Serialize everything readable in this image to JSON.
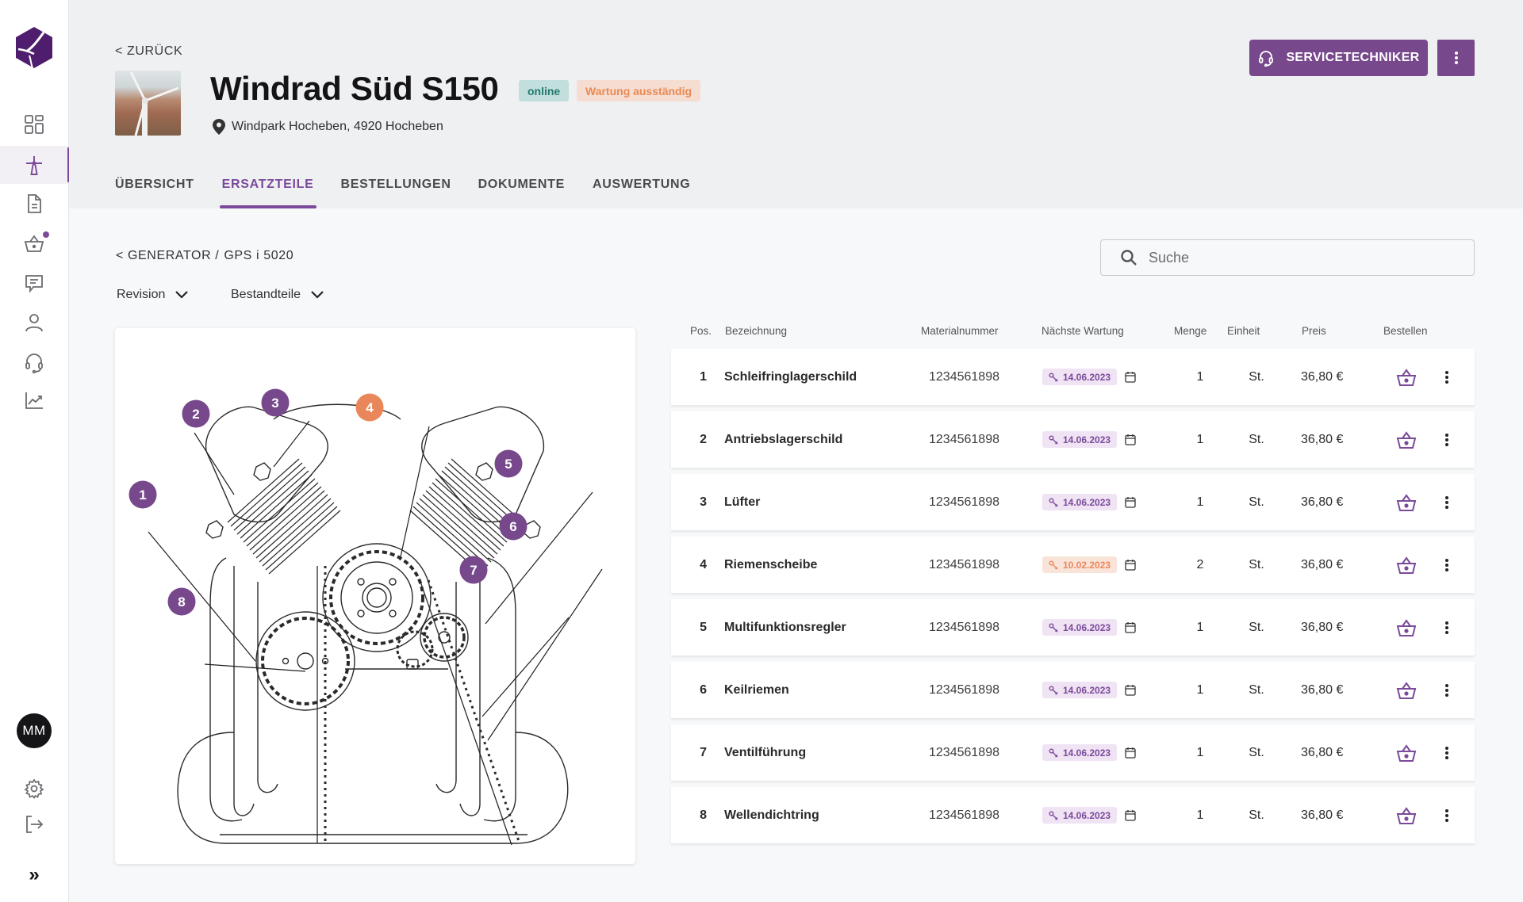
{
  "sidebar": {
    "logo": "windpark-logo",
    "items": [
      {
        "name": "dashboard",
        "icon": "dashboard-grid-icon",
        "active": false
      },
      {
        "name": "wind-turbines",
        "icon": "wind-turbine-icon",
        "active": true
      },
      {
        "name": "documents",
        "icon": "document-icon",
        "active": false
      },
      {
        "name": "cart",
        "icon": "basket-icon",
        "active": false,
        "notification": true
      },
      {
        "name": "messages",
        "icon": "chat-icon",
        "active": false
      },
      {
        "name": "users",
        "icon": "user-icon",
        "active": false
      },
      {
        "name": "support",
        "icon": "headset-icon",
        "active": false
      },
      {
        "name": "analytics",
        "icon": "chart-icon",
        "active": false
      }
    ],
    "avatar_initials": "MM",
    "bottom": [
      {
        "name": "settings",
        "icon": "gear-icon"
      },
      {
        "name": "logout",
        "icon": "logout-icon"
      },
      {
        "name": "expand",
        "icon": "double-chevron-right-icon"
      }
    ],
    "expand_glyph": "»"
  },
  "header": {
    "back_label": "< ZURÜCK",
    "title": "Windrad Süd S150",
    "badges": {
      "online": "online",
      "maintenance": "Wartung ausständig"
    },
    "location": "Windpark Hocheben, 4920 Hocheben",
    "service_button": "SERVICETECHNIKER",
    "tabs": [
      {
        "label": "ÜBERSICHT",
        "active": false
      },
      {
        "label": "ERSATZTEILE",
        "active": true
      },
      {
        "label": "BESTELLUNGEN",
        "active": false
      },
      {
        "label": "DOKUMENTE",
        "active": false
      },
      {
        "label": "AUSWERTUNG",
        "active": false
      }
    ]
  },
  "content": {
    "breadcrumb": {
      "parent": "< GENERATOR /",
      "current": "GPS i 5020"
    },
    "filters": {
      "revision": "Revision",
      "components": "Bestandteile"
    },
    "search": {
      "placeholder": "Suche",
      "value": ""
    }
  },
  "diagram": {
    "markers": [
      {
        "label": "1",
        "status": "ok"
      },
      {
        "label": "2",
        "status": "ok"
      },
      {
        "label": "3",
        "status": "ok"
      },
      {
        "label": "4",
        "status": "due"
      },
      {
        "label": "5",
        "status": "ok"
      },
      {
        "label": "6",
        "status": "ok"
      },
      {
        "label": "7",
        "status": "ok"
      },
      {
        "label": "8",
        "status": "ok"
      }
    ]
  },
  "colors": {
    "accent": "#77488c",
    "accent_text": "#7b4a9a",
    "warning": "#e9875a",
    "online": "#207a6e"
  },
  "table": {
    "columns": [
      "Pos.",
      "Bezeichnung",
      "Materialnummer",
      "Nächste Wartung",
      "Menge",
      "Einheit",
      "Preis",
      "Bestellen"
    ],
    "rows": [
      {
        "pos": "1",
        "name": "Schleifringlagerschild",
        "material": "1234561898",
        "next_maintenance": "14.06.2023",
        "status": "ok",
        "qty": "1",
        "unit": "St.",
        "price": "36,80 €"
      },
      {
        "pos": "2",
        "name": "Antriebslagerschild",
        "material": "1234561898",
        "next_maintenance": "14.06.2023",
        "status": "ok",
        "qty": "1",
        "unit": "St.",
        "price": "36,80 €"
      },
      {
        "pos": "3",
        "name": "Lüfter",
        "material": "1234561898",
        "next_maintenance": "14.06.2023",
        "status": "ok",
        "qty": "1",
        "unit": "St.",
        "price": "36,80 €"
      },
      {
        "pos": "4",
        "name": "Riemenscheibe",
        "material": "1234561898",
        "next_maintenance": "10.02.2023",
        "status": "due",
        "qty": "2",
        "unit": "St.",
        "price": "36,80 €"
      },
      {
        "pos": "5",
        "name": "Multifunktionsregler",
        "material": "1234561898",
        "next_maintenance": "14.06.2023",
        "status": "ok",
        "qty": "1",
        "unit": "St.",
        "price": "36,80 €"
      },
      {
        "pos": "6",
        "name": "Keilriemen",
        "material": "1234561898",
        "next_maintenance": "14.06.2023",
        "status": "ok",
        "qty": "1",
        "unit": "St.",
        "price": "36,80 €"
      },
      {
        "pos": "7",
        "name": "Ventilführung",
        "material": "1234561898",
        "next_maintenance": "14.06.2023",
        "status": "ok",
        "qty": "1",
        "unit": "St.",
        "price": "36,80 €"
      },
      {
        "pos": "8",
        "name": "Wellendichtring",
        "material": "1234561898",
        "next_maintenance": "14.06.2023",
        "status": "ok",
        "qty": "1",
        "unit": "St.",
        "price": "36,80 €"
      }
    ]
  }
}
